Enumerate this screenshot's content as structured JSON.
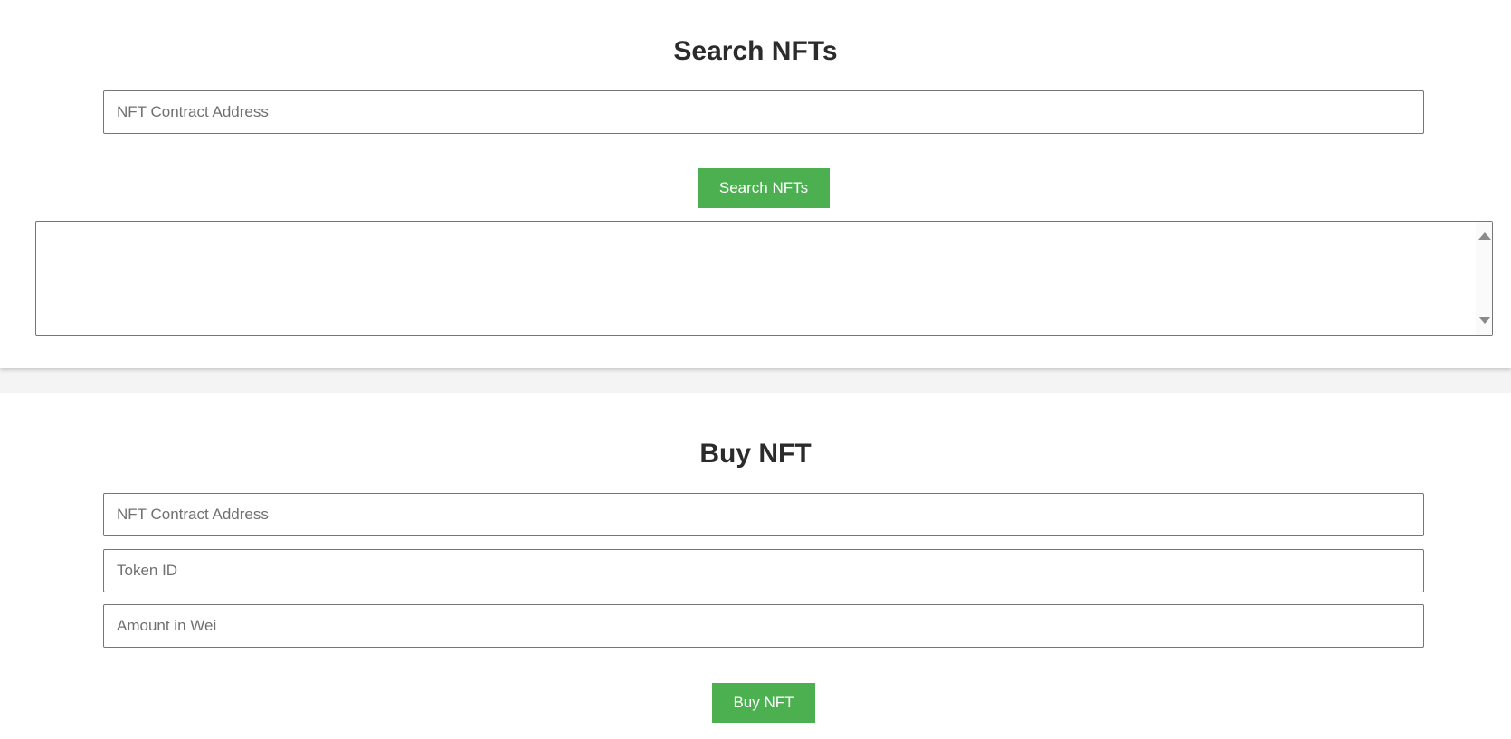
{
  "search": {
    "title": "Search NFTs",
    "contract_placeholder": "NFT Contract Address",
    "button_label": "Search NFTs",
    "results_value": ""
  },
  "buy": {
    "title": "Buy NFT",
    "contract_placeholder": "NFT Contract Address",
    "token_placeholder": "Token ID",
    "amount_placeholder": "Amount in Wei",
    "button_label": "Buy NFT"
  },
  "colors": {
    "accent": "#4caf50"
  }
}
